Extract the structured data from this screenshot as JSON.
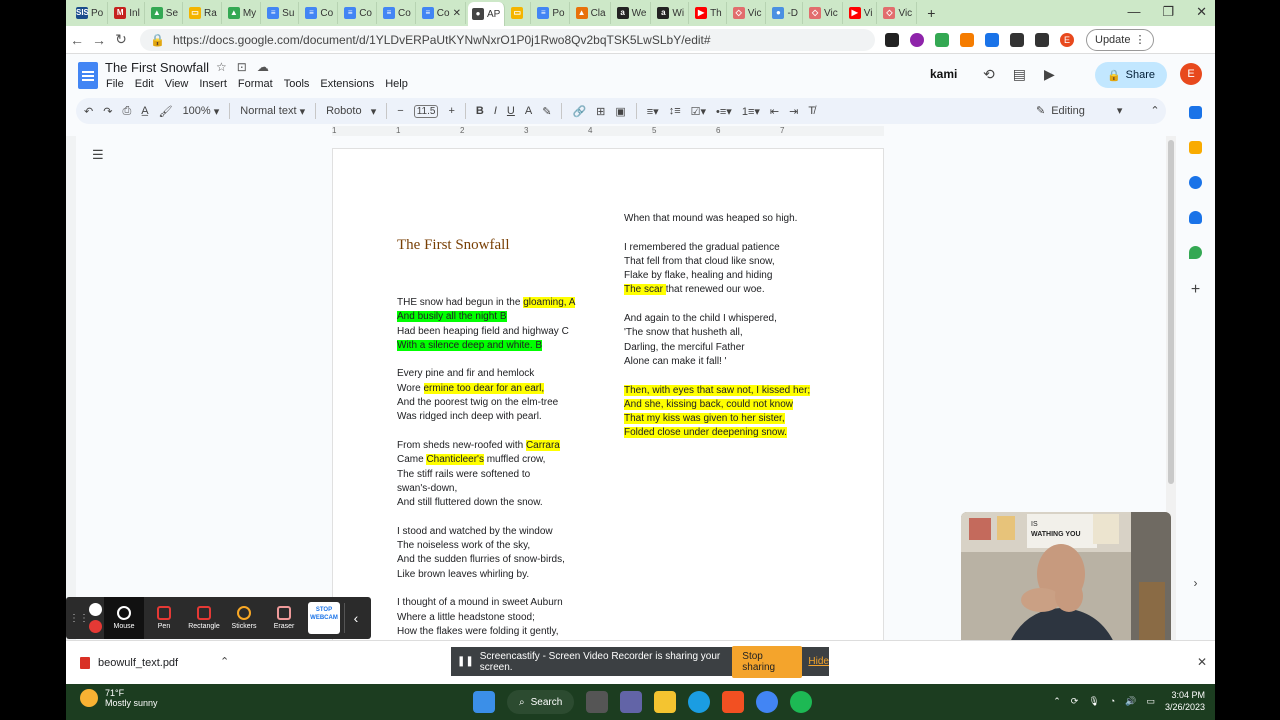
{
  "browser": {
    "tabs": [
      {
        "label": "Po",
        "color": "#1a4c8c",
        "fav": "SIS"
      },
      {
        "label": "Inl",
        "color": "#c5221f",
        "fav": "M"
      },
      {
        "label": "Se",
        "color": "#34a853",
        "fav": "▲"
      },
      {
        "label": "Ra",
        "color": "#f4b400",
        "fav": "▭"
      },
      {
        "label": "My",
        "color": "#34a853",
        "fav": "▲"
      },
      {
        "label": "Su",
        "color": "#4285f4",
        "fav": "≡"
      },
      {
        "label": "Co",
        "color": "#4285f4",
        "fav": "≡"
      },
      {
        "label": "Co",
        "color": "#4285f4",
        "fav": "≡"
      },
      {
        "label": "Co",
        "color": "#4285f4",
        "fav": "≡"
      },
      {
        "label": "Co",
        "color": "#4285f4",
        "fav": "≡"
      },
      {
        "label": "AP",
        "color": "#444444",
        "fav": "●"
      },
      {
        "label": "",
        "color": "#f4b400",
        "fav": "▭"
      },
      {
        "label": "Po",
        "color": "#4285f4",
        "fav": "≡"
      },
      {
        "label": "Cla",
        "color": "#e8710a",
        "fav": "▲"
      },
      {
        "label": "We",
        "color": "#222222",
        "fav": "a"
      },
      {
        "label": "Wi",
        "color": "#222222",
        "fav": "a"
      },
      {
        "label": "Th",
        "color": "#ff0000",
        "fav": "▶"
      },
      {
        "label": "Vic",
        "color": "#e26d6d",
        "fav": "◇"
      },
      {
        "label": "-D",
        "color": "#4a90e2",
        "fav": "●"
      },
      {
        "label": "Vic",
        "color": "#e26d6d",
        "fav": "◇"
      },
      {
        "label": "Vi",
        "color": "#ff0000",
        "fav": "▶"
      },
      {
        "label": "Vic",
        "color": "#e26d6d",
        "fav": "◇"
      }
    ],
    "url": "https://docs.google.com/document/d/1YLDvERPaUtKYNwNxrO1P0j1Rwo8Qv2bqTSK5LwSLbY/edit#",
    "update_label": "Update",
    "profile_initial": "E"
  },
  "doc": {
    "title": "The First Snowfall",
    "menus": [
      "File",
      "Edit",
      "View",
      "Insert",
      "Format",
      "Tools",
      "Extensions",
      "Help"
    ],
    "kami": "kami",
    "share_label": "Share",
    "avatar_initial": "E",
    "toolbar": {
      "zoom": "100%",
      "style": "Normal text",
      "font": "Roboto",
      "size": "11.5",
      "mode": "Editing"
    },
    "ruler": [
      "1",
      "1",
      "2",
      "3",
      "4",
      "5",
      "6",
      "7"
    ]
  },
  "poem": {
    "title": "The First Snowfall",
    "col1": [
      [
        [
          {
            "t": "THE snow had begun in the "
          },
          {
            "t": "gloaming, A",
            "h": "y"
          }
        ],
        [
          {
            "t": "And busily all the night B",
            "h": "g"
          }
        ],
        [
          {
            "t": "Had been heaping field and highway C"
          }
        ],
        [
          {
            "t": "With a silence deep and white. B",
            "h": "g"
          }
        ]
      ],
      [
        [
          {
            "t": "Every pine and fir and hemlock"
          }
        ],
        [
          {
            "t": "Wore "
          },
          {
            "t": "ermine too dear for an earl,",
            "h": "y"
          }
        ],
        [
          {
            "t": "And the poorest twig on the elm-tree"
          }
        ],
        [
          {
            "t": "Was ridged inch deep with pearl."
          }
        ]
      ],
      [
        [
          {
            "t": "From sheds new-roofed with "
          },
          {
            "t": "Carrara",
            "h": "y"
          }
        ],
        [
          {
            "t": "Came "
          },
          {
            "t": "Chanticleer's",
            "h": "y"
          },
          {
            "t": " muffled crow,"
          }
        ],
        [
          {
            "t": "The stiff rails were softened to"
          }
        ],
        [
          {
            "t": "swan's-down,"
          }
        ],
        [
          {
            "t": "And still fluttered down the snow."
          }
        ]
      ],
      [
        [
          {
            "t": "I stood and watched by the window"
          }
        ],
        [
          {
            "t": "The noiseless work of the sky,"
          }
        ],
        [
          {
            "t": "And the sudden flurries of snow-birds,"
          }
        ],
        [
          {
            "t": "Like brown leaves whirling by."
          }
        ]
      ],
      [
        [
          {
            "t": "I thought of a mound in sweet Auburn"
          }
        ],
        [
          {
            "t": "Where a little headstone stood;"
          }
        ],
        [
          {
            "t": "How the flakes were folding it gently,"
          }
        ]
      ]
    ],
    "col2": [
      [
        [
          {
            "t": "When that mound was heaped so high."
          }
        ]
      ],
      [
        [
          {
            "t": "I remembered the gradual patience"
          }
        ],
        [
          {
            "t": "That fell from that cloud like snow,"
          }
        ],
        [
          {
            "t": "Flake by flake, healing and hiding"
          }
        ],
        [
          {
            "t": "The scar ",
            "h": "y"
          },
          {
            "t": "that renewed our woe."
          }
        ]
      ],
      [
        [
          {
            "t": "And again to the child I whispered,"
          }
        ],
        [
          {
            "t": "'The snow that husheth all,"
          }
        ],
        [
          {
            "t": "Darling, the merciful Father"
          }
        ],
        [
          {
            "t": "Alone can make it fall! '"
          }
        ]
      ],
      [
        [
          {
            "t": "Then, with eyes that saw not, I kissed her;",
            "h": "y"
          }
        ],
        [
          {
            "t": "And she, kissing back, could not know",
            "h": "y"
          }
        ],
        [
          {
            "t": "That my kiss was given to her sister,",
            "h": "y"
          }
        ],
        [
          {
            "t": "Folded close under deepening snow.",
            "h": "y"
          }
        ]
      ]
    ]
  },
  "screencastify_toolbar": {
    "tools": [
      "Mouse",
      "Pen",
      "Rectangle",
      "Stickers",
      "Eraser"
    ],
    "stop_webcam": "STOP WEBCAM"
  },
  "downloads": {
    "file": "beowulf_text.pdf"
  },
  "share_notice": {
    "text": "Screencastify - Screen Video Recorder is sharing your screen.",
    "stop_label": "Stop sharing",
    "hide_label": "Hide"
  },
  "taskbar": {
    "temp": "71°F",
    "weather": "Mostly sunny",
    "search_label": "Search",
    "time": "3:04 PM",
    "date": "3/26/2023"
  }
}
